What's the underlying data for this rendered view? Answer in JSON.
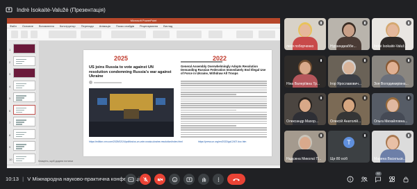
{
  "presenter": {
    "label": "Indrė Isokaitė-Valužė (Презентація)"
  },
  "shared_screen": {
    "window_title": "Microsoft PowerPoint",
    "ribbon_tabs": [
      "Файл",
      "Основне",
      "Вставлення",
      "Конструктор",
      "Переходи",
      "Анімація",
      "Показ слайдів",
      "Рецензування",
      "Вигляд"
    ],
    "slide_numbers": [
      "1",
      "2",
      "3",
      "4",
      "5",
      "6",
      "7",
      "8",
      "9",
      "10"
    ],
    "notes_placeholder": "Клацніть, щоб додати нотатки",
    "slide": {
      "year_left": "2025",
      "year_right": "2022",
      "headline_left": "US joins Russia to vote against UN resolution condemning Russia's war against Ukraine",
      "url_left": "https://edition.cnn.com/2025/02/24/politics/us-un-vote-russia-ukraine-resolution/index.html",
      "headline_right": "General Assembly Overwhelmingly Adopts Resolution Demanding Russian Federation Immediately End Illegal Use of Force in Ukraine, Withdraw All Troops",
      "url_right": "https://press.un.org/en/2022/ga12407.doc.htm"
    }
  },
  "participants": [
    {
      "name": "леся поборченко"
    },
    {
      "name": "Нурзиндиаббе..."
    },
    {
      "name": "Indrė Isokaitė-Valuž..."
    },
    {
      "name": "Ніна Валеріївна Тр..."
    },
    {
      "name": "Ігор Ярославович..."
    },
    {
      "name": "Зоя Володимирівна..."
    },
    {
      "name": "Олександр Махор..."
    },
    {
      "name": "Олексій Анатолій..."
    },
    {
      "name": "Ольга Михайловна..."
    },
    {
      "name": "Надєжна Миколаї П..."
    },
    {
      "name": "Ще 80 осіб",
      "avatar_letter": "T"
    },
    {
      "name": "Марина Васильєв..."
    }
  ],
  "bottom_bar": {
    "time": "10:13",
    "separator": "|",
    "meeting_title": "V Міжнародна науково-практична конференція...",
    "participant_count": "92"
  },
  "colors": {
    "background": "#202124",
    "end_call": "#ea4335",
    "ppt_accent": "#b7472a"
  }
}
